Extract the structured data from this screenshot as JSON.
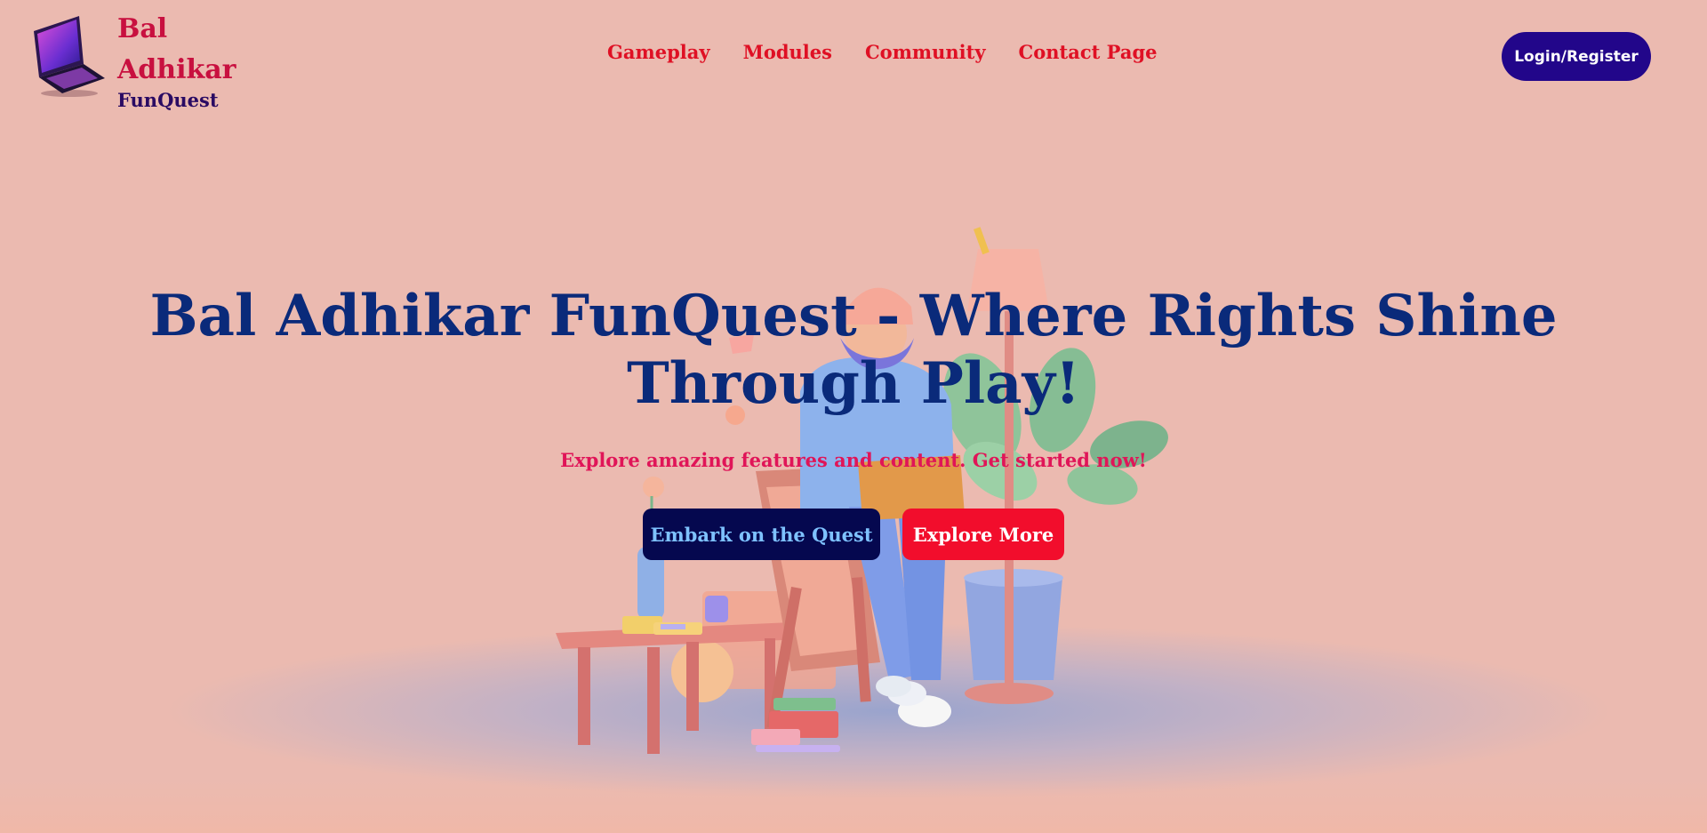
{
  "header": {
    "brand_title": "Bal Adhikar",
    "brand_subtitle": "FunQuest",
    "logo_icon": "laptop-icon",
    "nav": [
      {
        "label": "Gameplay"
      },
      {
        "label": "Modules"
      },
      {
        "label": "Community"
      },
      {
        "label": "Contact Page"
      }
    ],
    "login_label": "Login/Register"
  },
  "hero": {
    "title": "Bal Adhikar FunQuest - Where Rights Shine Through Play!",
    "subtitle": "Explore amazing features and content. Get started now!",
    "primary_button": "Embark on the Quest",
    "secondary_button": "Explore More",
    "illustration": "person-with-laptop-illustration"
  },
  "colors": {
    "background": "#ebbab0",
    "brand": "#c8103f",
    "nav": "#df1024",
    "login_bg": "#22068a",
    "title": "#0a2a7a",
    "subtitle": "#e01558",
    "primary_bg": "#05084f",
    "primary_text": "#7ec2ff",
    "secondary_bg": "#f20d2c"
  }
}
